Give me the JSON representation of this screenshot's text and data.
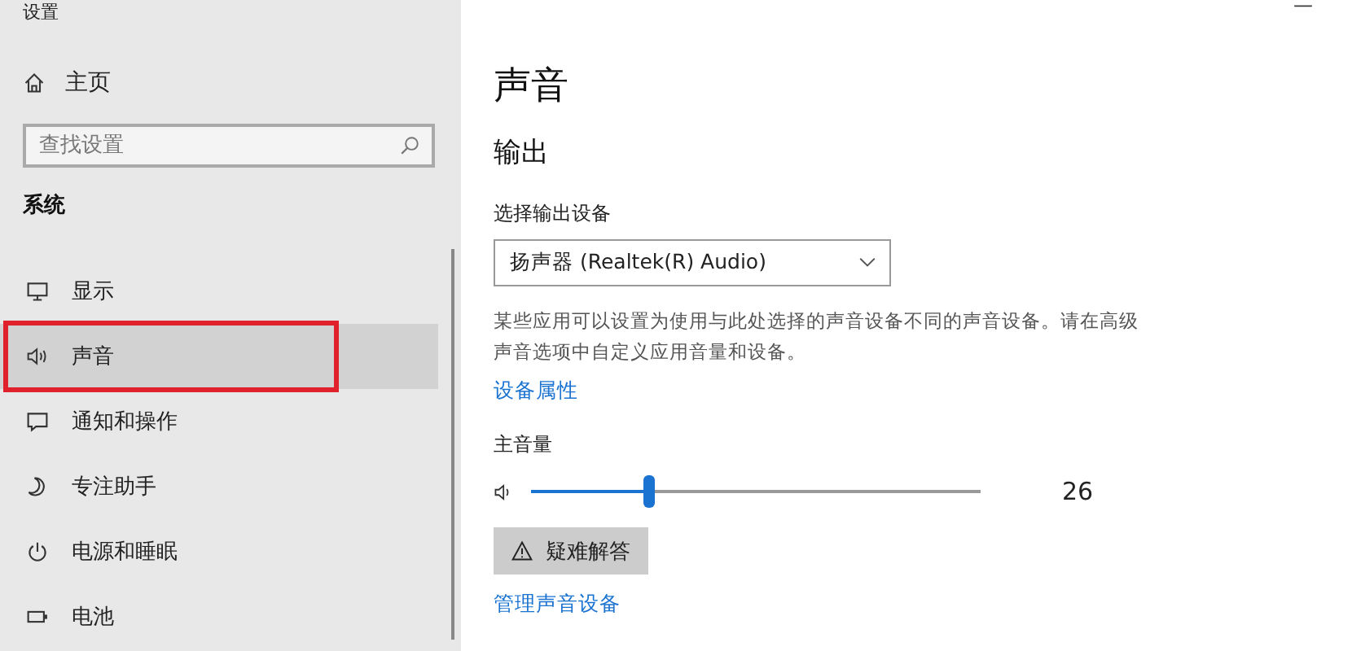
{
  "window": {
    "title": "设置",
    "minimize_glyph": "—"
  },
  "sidebar": {
    "home": "主页",
    "search": {
      "placeholder": "查找设置"
    },
    "section": "系统",
    "items": [
      {
        "label": "显示",
        "selected": false,
        "highlighted": false
      },
      {
        "label": "声音",
        "selected": true,
        "highlighted": true
      },
      {
        "label": "通知和操作",
        "selected": false,
        "highlighted": false
      },
      {
        "label": "专注助手",
        "selected": false,
        "highlighted": false
      },
      {
        "label": "电源和睡眠",
        "selected": false,
        "highlighted": false
      },
      {
        "label": "电池",
        "selected": false,
        "highlighted": false
      }
    ]
  },
  "main": {
    "title": "声音",
    "section": "输出",
    "device_label": "选择输出设备",
    "device": "扬声器 (Realtek(R) Audio)",
    "description": "某些应用可以设置为使用与此处选择的声音设备不同的声音设备。请在高级声音选项中自定义应用音量和设备。",
    "properties_link": "设备属性",
    "volume_label": "主音量",
    "volume": {
      "level": 0.26,
      "reading": "26"
    },
    "troubleshoot": "疑难解答",
    "manage_link": "管理声音设备"
  }
}
